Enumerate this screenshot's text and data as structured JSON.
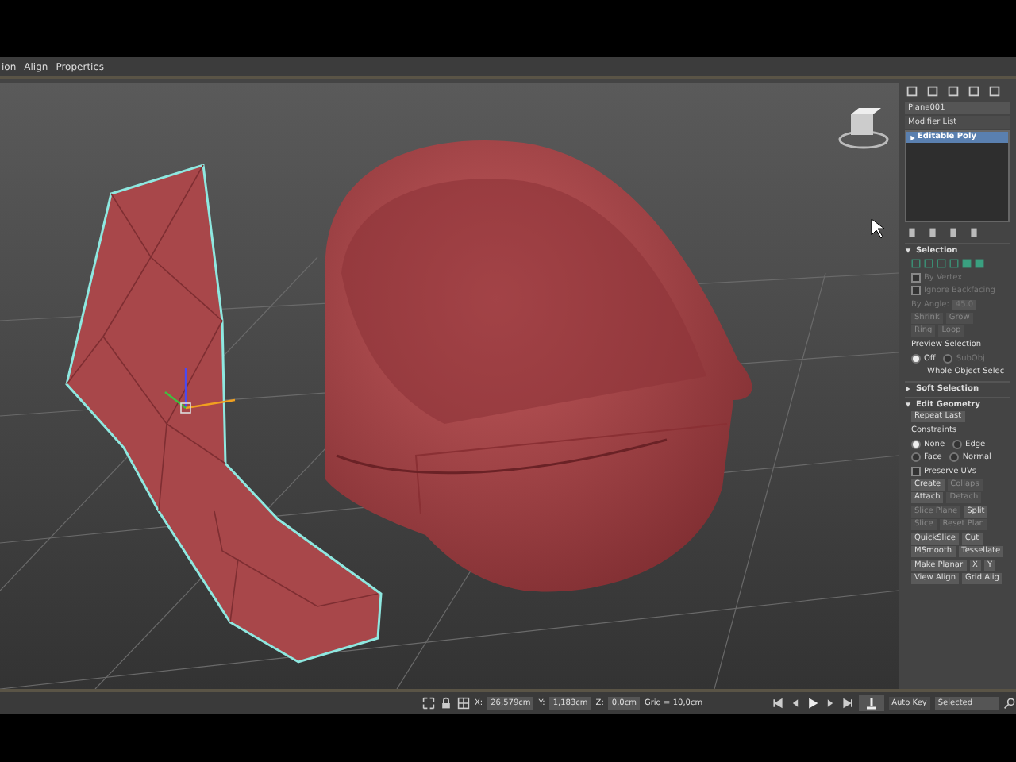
{
  "menu_bar": {
    "items": [
      "ion",
      "Align",
      "Properties"
    ]
  },
  "command_panel": {
    "object_name": "Plane001",
    "modifier_list_label": "Modifier List",
    "modifier_stack": [
      {
        "label": "Editable Poly",
        "selected": true
      }
    ],
    "rollouts": [
      {
        "title": "Selection",
        "expanded": true,
        "rows": [
          {
            "kind": "icons"
          },
          {
            "kind": "check",
            "label": "By Vertex",
            "checked": false,
            "disabled": true
          },
          {
            "kind": "check",
            "label": "Ignore Backfacing",
            "checked": false,
            "disabled": true
          },
          {
            "kind": "spinner",
            "label": "By Angle:",
            "value": "45.0",
            "disabled": true
          },
          {
            "kind": "buttons",
            "buttons": [
              {
                "label": "Shrink",
                "disabled": true
              },
              {
                "label": "Grow",
                "disabled": true
              }
            ]
          },
          {
            "kind": "buttons",
            "buttons": [
              {
                "label": "Ring",
                "disabled": true
              },
              {
                "label": "Loop",
                "disabled": true
              }
            ]
          },
          {
            "kind": "label",
            "label": "Preview Selection"
          },
          {
            "kind": "radios",
            "options": [
              {
                "label": "Off",
                "selected": true,
                "disabled": false
              },
              {
                "label": "SubObj",
                "selected": false,
                "disabled": true
              }
            ]
          },
          {
            "kind": "note",
            "label": "Whole Object Selec"
          }
        ]
      },
      {
        "title": "Soft Selection",
        "expanded": false
      },
      {
        "title": "Edit Geometry",
        "expanded": true,
        "rows": [
          {
            "kind": "buttons",
            "buttons": [
              {
                "label": "Repeat Last",
                "disabled": false
              }
            ]
          },
          {
            "kind": "label",
            "label": "Constraints"
          },
          {
            "kind": "radios",
            "options": [
              {
                "label": "None",
                "selected": true,
                "disabled": false
              },
              {
                "label": "Edge",
                "selected": false,
                "disabled": false
              }
            ]
          },
          {
            "kind": "radios",
            "options": [
              {
                "label": "Face",
                "selected": false,
                "disabled": false
              },
              {
                "label": "Normal",
                "selected": false,
                "disabled": false
              }
            ]
          },
          {
            "kind": "check",
            "label": "Preserve UVs",
            "checked": false,
            "disabled": false
          },
          {
            "kind": "buttons",
            "buttons": [
              {
                "label": "Create",
                "disabled": false
              },
              {
                "label": "Collaps",
                "disabled": true
              }
            ]
          },
          {
            "kind": "buttons",
            "buttons": [
              {
                "label": "Attach",
                "disabled": false
              },
              {
                "label": "Detach",
                "disabled": true
              }
            ]
          },
          {
            "kind": "buttons",
            "buttons": [
              {
                "label": "Slice Plane",
                "disabled": true
              },
              {
                "label": "Split",
                "disabled": false
              }
            ]
          },
          {
            "kind": "buttons",
            "buttons": [
              {
                "label": "Slice",
                "disabled": true
              },
              {
                "label": "Reset Plan",
                "disabled": true
              }
            ]
          },
          {
            "kind": "buttons",
            "buttons": [
              {
                "label": "QuickSlice",
                "disabled": false
              },
              {
                "label": "Cut",
                "disabled": false
              }
            ]
          },
          {
            "kind": "buttons",
            "buttons": [
              {
                "label": "MSmooth",
                "disabled": false
              },
              {
                "label": "Tessellate",
                "disabled": false
              }
            ]
          },
          {
            "kind": "buttons",
            "buttons": [
              {
                "label": "Make Planar",
                "disabled": false
              },
              {
                "label": "X",
                "disabled": false
              },
              {
                "label": "Y",
                "disabled": false
              }
            ]
          },
          {
            "kind": "buttons",
            "buttons": [
              {
                "label": "View Align",
                "disabled": false
              },
              {
                "label": "Grid Alig",
                "disabled": false
              }
            ]
          }
        ]
      }
    ]
  },
  "status_bar": {
    "x_label": "X:",
    "x_value": "26,579cm",
    "y_label": "Y:",
    "y_value": "1,183cm",
    "z_label": "Z:",
    "z_value": "0,0cm",
    "grid": "Grid = 10,0cm",
    "auto_key": "Auto Key",
    "key_filter": "Selected"
  }
}
